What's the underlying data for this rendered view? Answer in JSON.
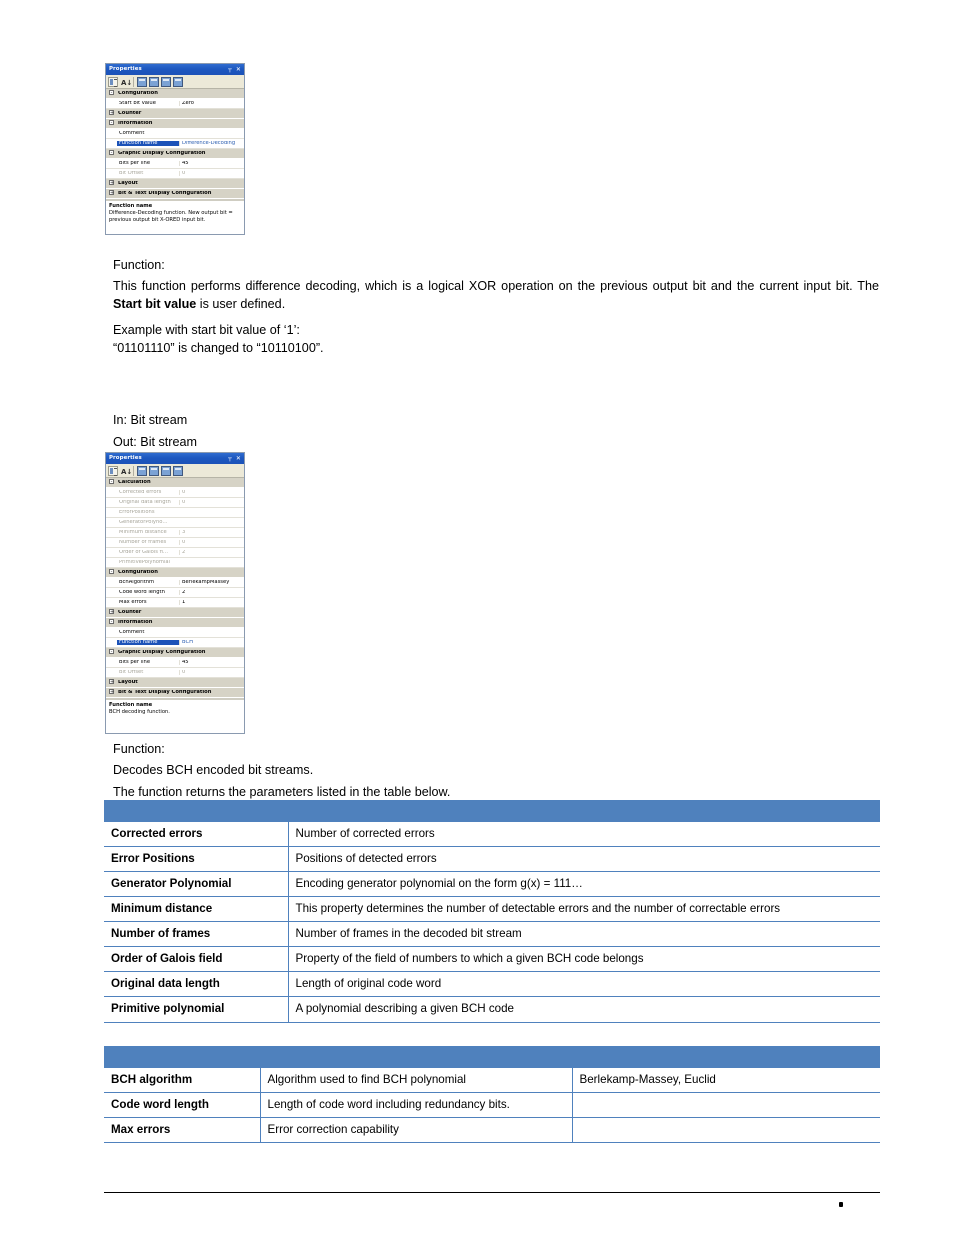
{
  "theme": {
    "table_header_blue": "#4F81BD",
    "titlebar_blue": "#1C52B8",
    "category_gray": "#D6D3C6",
    "selected_blue": "#1C52B8"
  },
  "panel1": {
    "title": "Properties",
    "pin_icon": "pin-icon",
    "close_icon": "close-icon",
    "toolbar": {
      "categorized_icon": "categorized-view-icon",
      "alphabetical_icon": "alphabetical-sort-icon",
      "page1_icon": "property-pages-icon",
      "page2_icon": "property-pages-icon",
      "page3_icon": "property-pages-icon",
      "page4_icon": "property-pages-icon",
      "sort_glyph": "A↓"
    },
    "rows": [
      {
        "type": "category",
        "twisty": "-",
        "name": "Configuration"
      },
      {
        "type": "prop",
        "name": "Start bit value",
        "value": "Zero",
        "dim": false,
        "selected": false
      },
      {
        "type": "category",
        "twisty": "+",
        "name": "Counter"
      },
      {
        "type": "category",
        "twisty": "-",
        "name": "Information"
      },
      {
        "type": "prop",
        "name": "Comment",
        "value": "",
        "dim": false,
        "selected": false
      },
      {
        "type": "prop",
        "name": "Function name",
        "value": "Difference-Decoding",
        "dim": false,
        "selected": true
      },
      {
        "type": "category",
        "twisty": "-",
        "name": "Graphic Display Configuration"
      },
      {
        "type": "prop",
        "name": "Bits per line",
        "value": "45",
        "dim": false,
        "selected": false
      },
      {
        "type": "prop",
        "name": "Bit Offset",
        "value": "0",
        "dim": true,
        "selected": false
      },
      {
        "type": "category",
        "twisty": "+",
        "name": "Layout"
      },
      {
        "type": "category",
        "twisty": "+",
        "name": "Bit & Text Display Configuration"
      }
    ],
    "description": {
      "title": "Function name",
      "body": "Difference-Decoding function. New output bit = previous output bit X-ORED input bit."
    }
  },
  "panel2": {
    "title": "Properties",
    "pin_icon": "pin-icon",
    "close_icon": "close-icon",
    "toolbar": {
      "categorized_icon": "categorized-view-icon",
      "alphabetical_icon": "alphabetical-sort-icon",
      "page1_icon": "property-pages-icon",
      "page2_icon": "property-pages-icon",
      "page3_icon": "property-pages-icon",
      "page4_icon": "property-pages-icon",
      "sort_glyph": "A↓"
    },
    "rows": [
      {
        "type": "category",
        "twisty": "-",
        "name": "Calculation"
      },
      {
        "type": "prop",
        "name": "Corrected errors",
        "value": "0",
        "dim": true,
        "selected": false
      },
      {
        "type": "prop",
        "name": "Original data length",
        "value": "0",
        "dim": true,
        "selected": false
      },
      {
        "type": "prop",
        "name": "ErrorPositions",
        "value": "",
        "dim": true,
        "selected": false
      },
      {
        "type": "prop",
        "name": "GeneratorPolyno…",
        "value": "",
        "dim": true,
        "selected": false
      },
      {
        "type": "prop",
        "name": "Minimum distance",
        "value": "3",
        "dim": true,
        "selected": false
      },
      {
        "type": "prop",
        "name": "Number of frames",
        "value": "0",
        "dim": true,
        "selected": false
      },
      {
        "type": "prop",
        "name": "Order of Galois fi…",
        "value": "2",
        "dim": true,
        "selected": false
      },
      {
        "type": "prop",
        "name": "PrimitivePolynomial",
        "value": "",
        "dim": true,
        "selected": false
      },
      {
        "type": "category",
        "twisty": "-",
        "name": "Configuration"
      },
      {
        "type": "prop",
        "name": "BchAlgorithm",
        "value": "BerlekampMassey",
        "dim": false,
        "selected": false
      },
      {
        "type": "prop",
        "name": "Code word length",
        "value": "2",
        "dim": false,
        "selected": false
      },
      {
        "type": "prop",
        "name": "Max errors",
        "value": "1",
        "dim": false,
        "selected": false
      },
      {
        "type": "category",
        "twisty": "+",
        "name": "Counter"
      },
      {
        "type": "category",
        "twisty": "-",
        "name": "Information"
      },
      {
        "type": "prop",
        "name": "Comment",
        "value": "",
        "dim": false,
        "selected": false
      },
      {
        "type": "prop",
        "name": "Function name",
        "value": "BCH",
        "dim": false,
        "selected": true
      },
      {
        "type": "category",
        "twisty": "-",
        "name": "Graphic Display Configuration"
      },
      {
        "type": "prop",
        "name": "Bits per line",
        "value": "45",
        "dim": false,
        "selected": false
      },
      {
        "type": "prop",
        "name": "Bit Offset",
        "value": "0",
        "dim": true,
        "selected": false
      },
      {
        "type": "category",
        "twisty": "+",
        "name": "Layout"
      },
      {
        "type": "category",
        "twisty": "+",
        "name": "Bit & Text Display Configuration"
      }
    ],
    "description": {
      "title": "Function name",
      "body": "BCH decoding function."
    }
  },
  "section1": {
    "function_label": "Function:",
    "description_pre": "This function performs difference decoding, which is a logical XOR operation on the previous output bit and the current input bit. The ",
    "description_bold": "Start bit value",
    "description_post": " is user defined.",
    "example_label": "Example with start bit value of ‘1’:",
    "example_text": "“01101110” is changed to “10110100”.",
    "in_label": "In: Bit stream",
    "out_label": "Out: Bit stream"
  },
  "section2": {
    "function_label": "Function:",
    "description": "Decodes BCH encoded bit streams.",
    "table_intro": "The function returns the parameters listed in the table below."
  },
  "table_returns": {
    "header": [
      "",
      ""
    ],
    "rows": [
      [
        "Corrected errors",
        "Number of corrected errors"
      ],
      [
        "Error Positions",
        "Positions of detected errors"
      ],
      [
        "Generator Polynomial",
        "Encoding generator polynomial on the form g(x) = 111…"
      ],
      [
        "Minimum distance",
        "This property determines the number of detectable errors and the number of correctable errors"
      ],
      [
        "Number of frames",
        "Number of frames in the decoded bit stream"
      ],
      [
        "Order of Galois field",
        "Property of the field of numbers to which a given BCH code belongs"
      ],
      [
        "Original data length",
        "Length of original code word"
      ],
      [
        "Primitive polynomial",
        "A polynomial describing a given BCH code"
      ]
    ]
  },
  "table_config": {
    "header": [
      "",
      "",
      ""
    ],
    "rows": [
      [
        "BCH algorithm",
        "Algorithm used to find BCH polynomial",
        "Berlekamp-Massey, Euclid"
      ],
      [
        "Code word length",
        "Length of code word including redundancy bits.",
        ""
      ],
      [
        "Max errors",
        "Error correction capability",
        ""
      ]
    ]
  },
  "footer": {
    "mark": ""
  }
}
